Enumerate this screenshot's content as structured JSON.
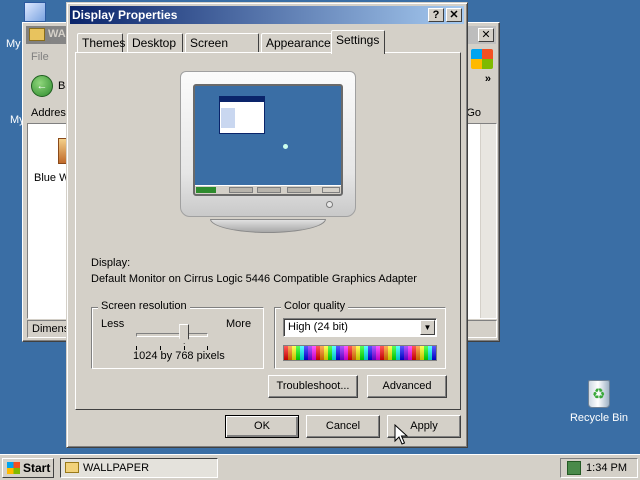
{
  "desktop": {
    "recycle_bin_label": "Recycle Bin",
    "my_docs_fragment": "My",
    "my_computer_fragment": "My"
  },
  "explorer": {
    "title_fragment": "WA",
    "menu_fragment": "File",
    "back_fragment": "Ba",
    "address_label": "Addres",
    "go_label": "Go",
    "file_label": "Blue W",
    "status_fragment": "Dimensio"
  },
  "dialog": {
    "title": "Display Properties",
    "help_glyph": "?",
    "close_glyph": "✕",
    "tabs": [
      "Themes",
      "Desktop",
      "Screen Saver",
      "Appearance",
      "Settings"
    ],
    "active_tab": "Settings",
    "display_label": "Display:",
    "display_device": "Default Monitor on Cirrus Logic 5446 Compatible Graphics Adapter",
    "resolution": {
      "legend": "Screen resolution",
      "less_label": "Less",
      "more_label": "More",
      "value_text": "1024 by 768 pixels",
      "level": 0.67
    },
    "color_quality": {
      "legend": "Color quality",
      "selected": "High (24 bit)",
      "dropdown_glyph": "▼"
    },
    "troubleshoot_label": "Troubleshoot...",
    "advanced_label": "Advanced",
    "ok_label": "OK",
    "cancel_label": "Cancel",
    "apply_label": "Apply"
  },
  "taskbar": {
    "start_label": "Start",
    "task_label": "WALLPAPER",
    "clock": "1:34 PM"
  },
  "colors": {
    "desktop": "#3a6ea5",
    "titlebar_active": "#0a246a",
    "face": "#d4d0c8"
  }
}
